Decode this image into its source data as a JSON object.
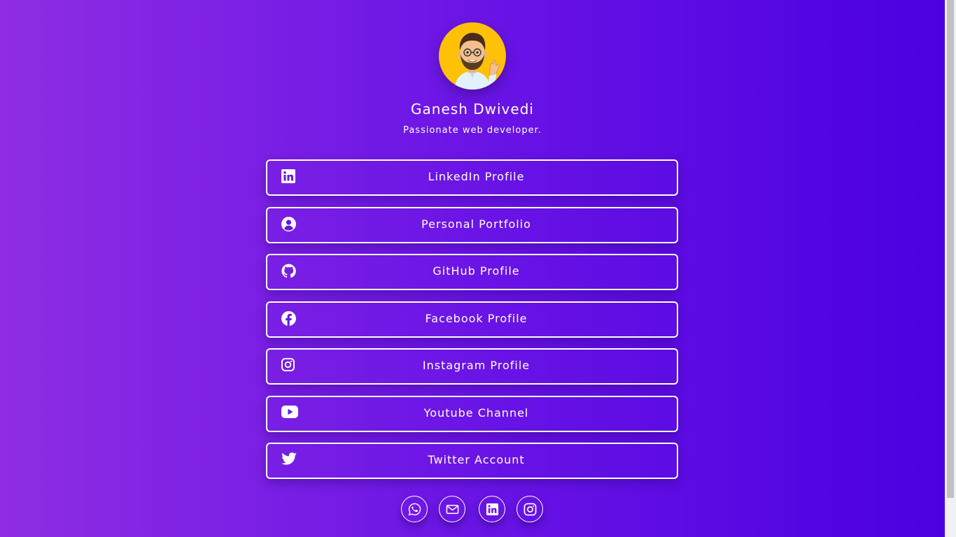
{
  "profile": {
    "name": "Ganesh Dwivedi",
    "bio": "Passionate web developer."
  },
  "links": [
    {
      "label": "LinkedIn Profile",
      "icon": "linkedin-icon"
    },
    {
      "label": "Personal Portfolio",
      "icon": "user-circle-icon"
    },
    {
      "label": "GitHub Profile",
      "icon": "github-icon"
    },
    {
      "label": "Facebook Profile",
      "icon": "facebook-icon"
    },
    {
      "label": "Instagram Profile",
      "icon": "instagram-icon"
    },
    {
      "label": "Youtube Channel",
      "icon": "youtube-icon"
    },
    {
      "label": "Twitter Account",
      "icon": "twitter-icon"
    }
  ],
  "social": [
    {
      "icon": "whatsapp-icon"
    },
    {
      "icon": "mail-icon"
    },
    {
      "icon": "linkedin-icon"
    },
    {
      "icon": "instagram-icon"
    }
  ],
  "colors": {
    "gradient_start": "#8e2de2",
    "gradient_end": "#4a00e0",
    "avatar_bg": "#ffc107",
    "foreground": "#ffffff"
  }
}
